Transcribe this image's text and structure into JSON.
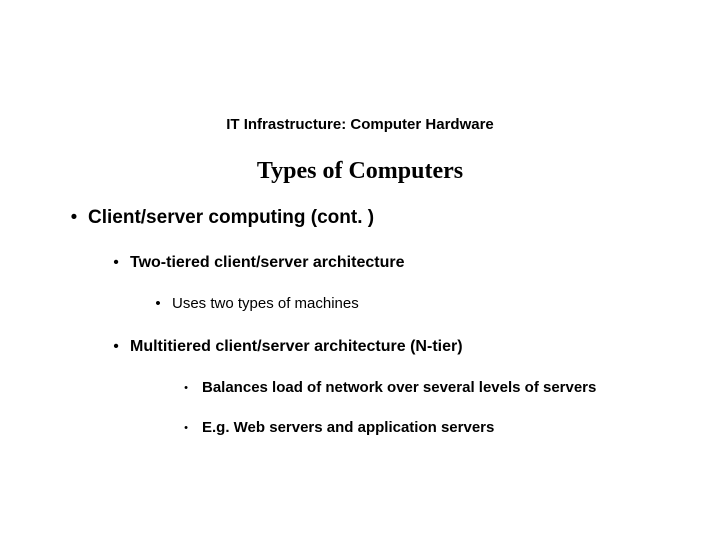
{
  "pretitle": "IT Infrastructure: Computer Hardware",
  "title": "Types of Computers",
  "l1": {
    "text": "Client/server computing (cont. )"
  },
  "l2a": {
    "text": "Two-tiered client/server architecture"
  },
  "l3a": {
    "text": "Uses two types of machines"
  },
  "l2b": {
    "text": "Multitiered client/server architecture (N-tier)"
  },
  "l4a": {
    "text": "Balances load of network over several levels of servers"
  },
  "l4b": {
    "text": "E.g. Web servers and application servers"
  },
  "bullet_char": "•"
}
